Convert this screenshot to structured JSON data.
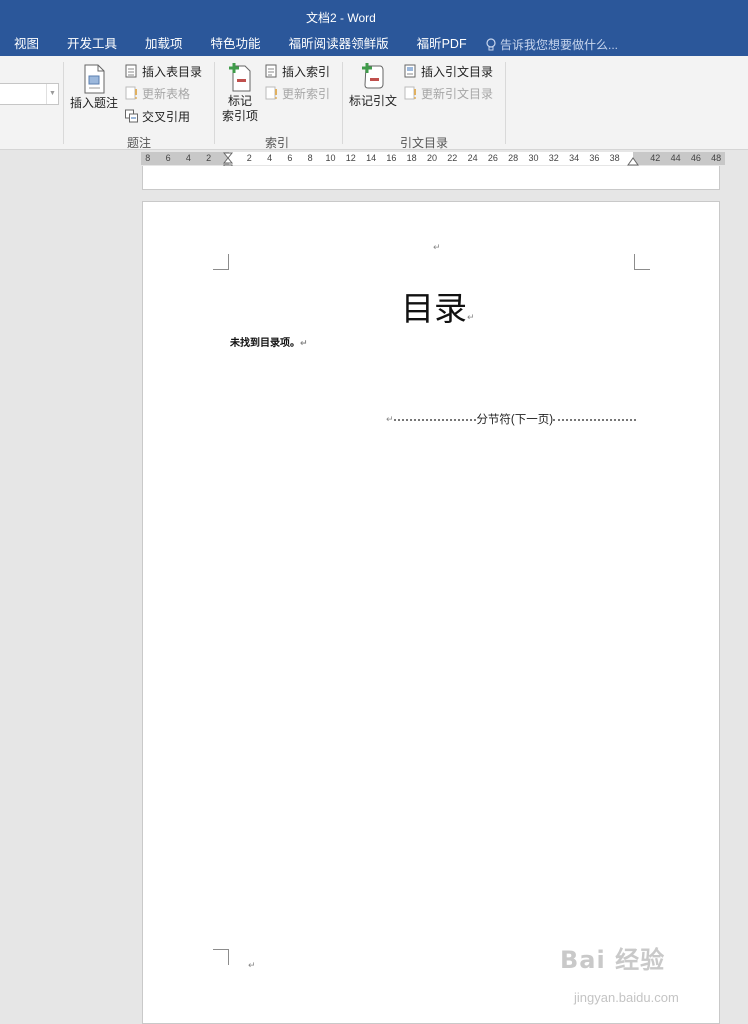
{
  "window": {
    "title": "文档2 - Word"
  },
  "tabs": [
    {
      "label": "视图"
    },
    {
      "label": "开发工具"
    },
    {
      "label": "加载项"
    },
    {
      "label": "特色功能"
    },
    {
      "label": "福昕阅读器领鲜版"
    },
    {
      "label": "福昕PDF"
    }
  ],
  "tell_me": {
    "placeholder": "告诉我您想要做什么..."
  },
  "ribbon": {
    "captions": {
      "insert_caption": "插入题注",
      "insert_table_of_figures": "插入表目录",
      "update_table": "更新表格",
      "cross_reference": "交叉引用",
      "group_label": "题注"
    },
    "index": {
      "mark_entry_line1": "标记",
      "mark_entry_line2": "索引项",
      "insert_index": "插入索引",
      "update_index": "更新索引",
      "group_label": "索引"
    },
    "citations": {
      "mark_citation": "标记引文",
      "insert_toa": "插入引文目录",
      "update_toa": "更新引文目录",
      "group_label": "引文目录"
    }
  },
  "ruler": {
    "labels": [
      "8",
      "6",
      "4",
      "2",
      "2",
      "4",
      "6",
      "8",
      "10",
      "12",
      "14",
      "16",
      "18",
      "20",
      "22",
      "24",
      "26",
      "28",
      "30",
      "32",
      "34",
      "36",
      "38",
      "42",
      "44",
      "46",
      "48"
    ]
  },
  "document": {
    "toc_heading": "目录",
    "toc_message": "未找到目录项。",
    "section_break": "分节符(下一页)"
  },
  "watermark": {
    "brand": "Bai 经验",
    "url": "jingyan.baidu.com"
  },
  "colors": {
    "title_bar": "#2b579a",
    "ribbon_bg": "#f3f3f3",
    "workspace": "#e6e6e6"
  }
}
